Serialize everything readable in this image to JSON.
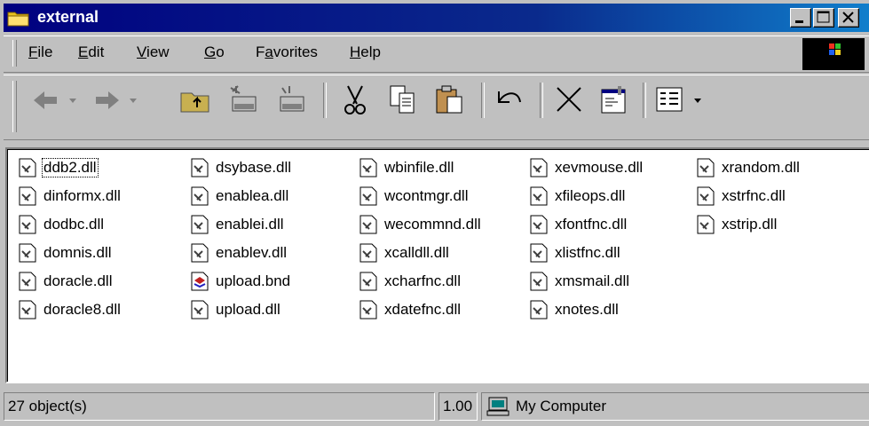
{
  "window": {
    "title": "external",
    "icon": "folder-icon",
    "controls": [
      "minimize-icon",
      "maximize-icon",
      "close-icon"
    ]
  },
  "menu": {
    "items": [
      "File",
      "Edit",
      "View",
      "Go",
      "Favorites",
      "Help"
    ]
  },
  "toolbar": {
    "buttons": [
      "back-icon",
      "forward-icon",
      "up-folder-icon",
      "map-drive-icon",
      "disconnect-drive-icon",
      "cut-icon",
      "copy-icon",
      "paste-icon",
      "undo-icon",
      "delete-icon",
      "properties-icon",
      "views-icon"
    ]
  },
  "files": {
    "col1": [
      "ddb2.dll",
      "dinformx.dll",
      "dodbc.dll",
      "domnis.dll",
      "doracle.dll",
      "doracle8.dll"
    ],
    "col2": [
      "dsybase.dll",
      "enablea.dll",
      "enablei.dll",
      "enablev.dll",
      "upload.bnd",
      "upload.dll"
    ],
    "col3": [
      "wbinfile.dll",
      "wcontmgr.dll",
      "wecommnd.dll",
      "xcalldll.dll",
      "xcharfnc.dll",
      "xdatefnc.dll"
    ],
    "col4": [
      "xevmouse.dll",
      "xfileops.dll",
      "xfontfnc.dll",
      "xlistfnc.dll",
      "xmsmail.dll",
      "xnotes.dll"
    ],
    "col5": [
      "xrandom.dll",
      "xstrfnc.dll",
      "xstrip.dll"
    ],
    "selected": "ddb2.dll"
  },
  "status": {
    "count": "27 object(s)",
    "size": "1.00",
    "zone": "My Computer",
    "zone_icon": "computer-icon"
  }
}
